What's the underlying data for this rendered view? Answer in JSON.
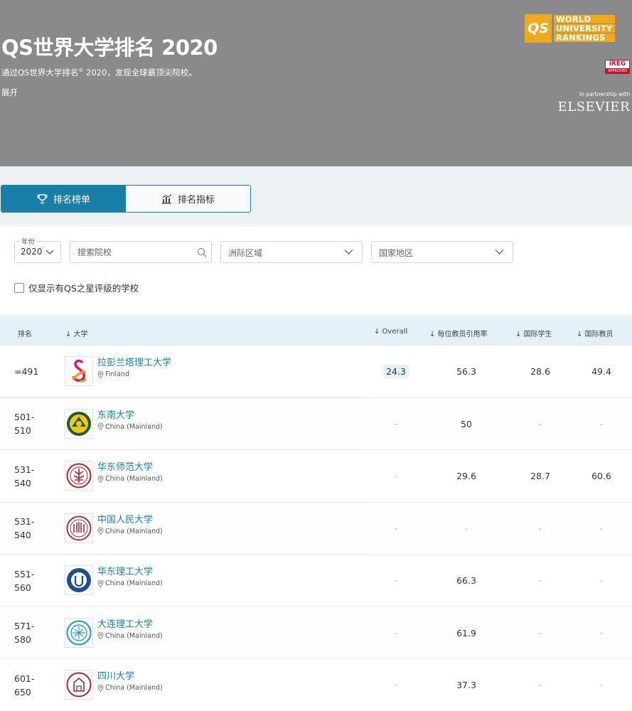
{
  "hero": {
    "title": "QS世界大学排名 2020",
    "subtitle_pre": "通过QS世界大学排名",
    "subtitle_sup": "®",
    "subtitle_post": " 2020，发现全球最顶尖院校。",
    "expand": "展开",
    "logo_box": "QS",
    "logo_words": [
      "WORLD",
      "UNIVERSITY",
      "RANKINGS"
    ],
    "ireg_top": "iREG",
    "ireg_bottom": "APPROVED",
    "partnership": "In partnership with",
    "partner_name": "ELSEVIER"
  },
  "tabs": [
    {
      "label": "排名榜单",
      "active": true
    },
    {
      "label": "排名指标",
      "active": false
    }
  ],
  "filters": {
    "year_label": "年份",
    "year_value": "2020",
    "search_placeholder": "搜索院校",
    "region_placeholder": "洲际区域",
    "country_placeholder": "国家地区",
    "star_checkbox_label": "仅显示有QS之星评级的学校"
  },
  "table": {
    "headers": {
      "rank": "排名",
      "university": "↓ 大学",
      "overall": "↓ Overall",
      "citations": "↓ 每位教员引用率",
      "intl_students": "↓ 国际学生",
      "intl_faculty": "↓ 国际教员"
    },
    "rows": [
      {
        "rank": "=491",
        "name": "拉彭兰塔理工大学",
        "country": "Finland",
        "overall": "24.3",
        "citations": "56.3",
        "intl_students": "28.6",
        "intl_faculty": "49.4"
      },
      {
        "rank": "501-\n510",
        "name": "东南大学",
        "country": "China (Mainland)",
        "overall": "-",
        "citations": "50",
        "intl_students": "-",
        "intl_faculty": "-"
      },
      {
        "rank": "531-\n540",
        "name": "华东师范大学",
        "country": "China (Mainland)",
        "overall": "-",
        "citations": "29.6",
        "intl_students": "28.7",
        "intl_faculty": "60.6"
      },
      {
        "rank": "531-\n540",
        "name": "中国人民大学",
        "country": "China (Mainland)",
        "overall": "-",
        "citations": "-",
        "intl_students": "-",
        "intl_faculty": "-"
      },
      {
        "rank": "551-\n560",
        "name": "华东理工大学",
        "country": "China (Mainland)",
        "overall": "-",
        "citations": "66.3",
        "intl_students": "-",
        "intl_faculty": "-"
      },
      {
        "rank": "571-\n580",
        "name": "大连理工大学",
        "country": "China (Mainland)",
        "overall": "-",
        "citations": "61.9",
        "intl_students": "-",
        "intl_faculty": "-"
      },
      {
        "rank": "601-\n650",
        "name": "四川大学",
        "country": "China (Mainland)",
        "overall": "-",
        "citations": "37.3",
        "intl_students": "-",
        "intl_faculty": "-"
      }
    ]
  },
  "colors": {
    "accent": "#1a7fa8",
    "hero_bg": "#8a8a8c",
    "qs_orange": "#f0a81c",
    "ireg_red": "#c8102e"
  }
}
